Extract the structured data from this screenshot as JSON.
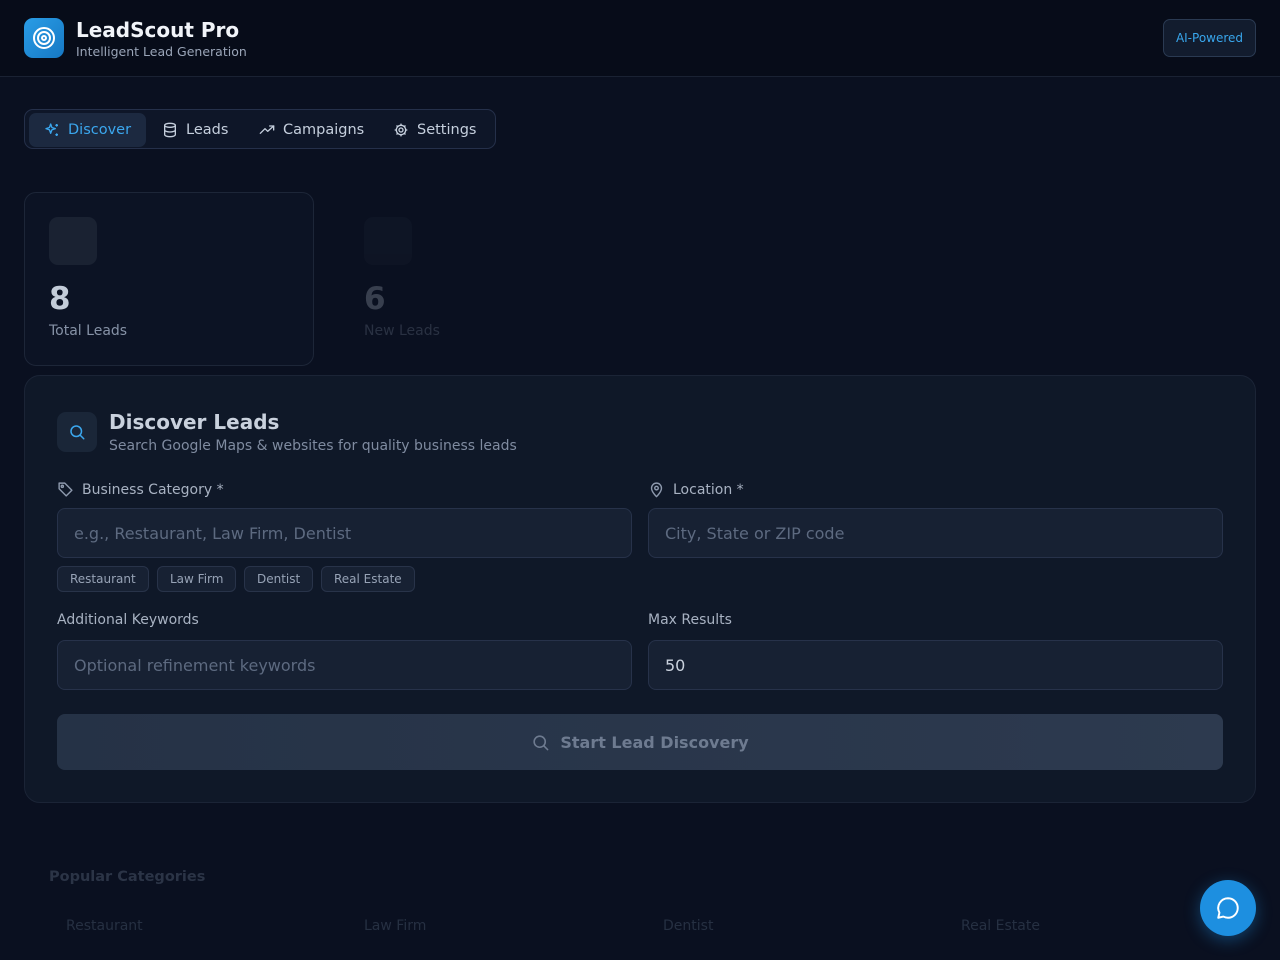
{
  "header": {
    "title": "LeadScout Pro",
    "subtitle": "Intelligent Lead Generation",
    "badge": "AI-Powered"
  },
  "nav": {
    "tabs": [
      {
        "label": "Discover",
        "icon": "sparkles-icon",
        "active": true
      },
      {
        "label": "Leads",
        "icon": "database-icon",
        "active": false
      },
      {
        "label": "Campaigns",
        "icon": "trending-up-icon",
        "active": false
      },
      {
        "label": "Settings",
        "icon": "gear-icon",
        "active": false
      }
    ]
  },
  "stats": [
    {
      "value": "8",
      "label": "Total Leads"
    },
    {
      "value": "6",
      "label": "New Leads"
    }
  ],
  "discover": {
    "title": "Discover Leads",
    "subtitle": "Search Google Maps & websites for quality business leads",
    "category_label": "Business Category *",
    "category_placeholder": "e.g., Restaurant, Law Firm, Dentist",
    "location_label": "Location *",
    "location_placeholder": "City, State or ZIP code",
    "chips": [
      "Restaurant",
      "Law Firm",
      "Dentist",
      "Real Estate"
    ],
    "keywords_label": "Additional Keywords",
    "keywords_placeholder": "Optional refinement keywords",
    "max_label": "Max Results",
    "max_value": "50",
    "button_label": "Start Lead Discovery"
  },
  "popular": {
    "title": "Popular Categories",
    "items": [
      "Restaurant",
      "Law Firm",
      "Dentist",
      "Real Estate"
    ]
  },
  "colors": {
    "accent": "#1d8fe0",
    "background": "#0a1020"
  }
}
